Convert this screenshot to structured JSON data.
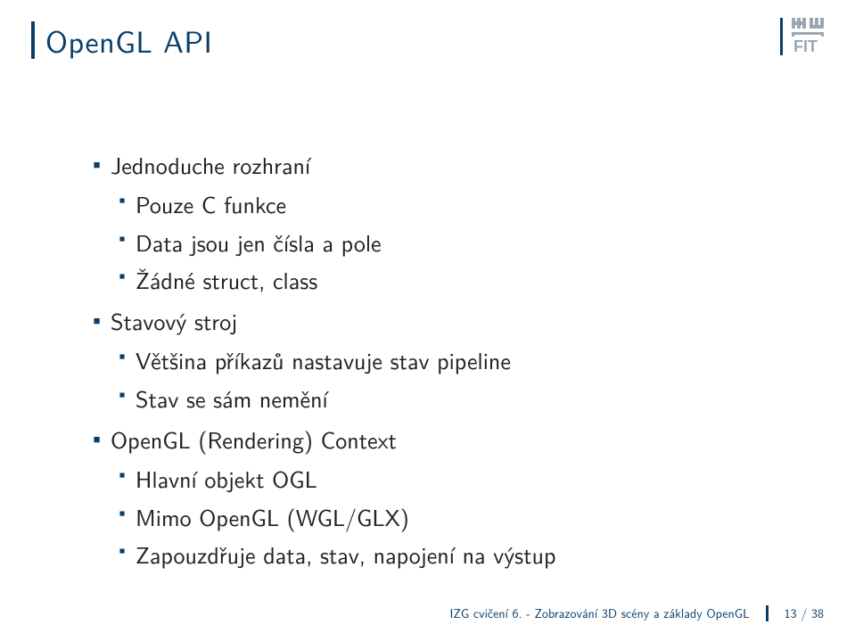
{
  "header": {
    "title": "OpenGL API"
  },
  "content": {
    "bullets": [
      {
        "text": "Jednoduche rozhraní",
        "sub": [
          "Pouze C funkce",
          "Data jsou jen čísla a pole",
          "Žádné struct, class"
        ]
      },
      {
        "text": "Stavový stroj",
        "sub": [
          "Většina příkazů nastavuje stav pipeline",
          "Stav se sám nemění"
        ]
      },
      {
        "text": "OpenGL (Rendering) Context",
        "sub": [
          "Hlavní objekt OGL",
          "Mimo OpenGL (WGL/GLX)",
          "Zapouzdřuje data, stav, napojení na výstup"
        ]
      }
    ]
  },
  "footer": {
    "text": "IZG cvičení 6. - Zobrazování 3D scény a základy OpenGL",
    "page": "13 / 38"
  }
}
